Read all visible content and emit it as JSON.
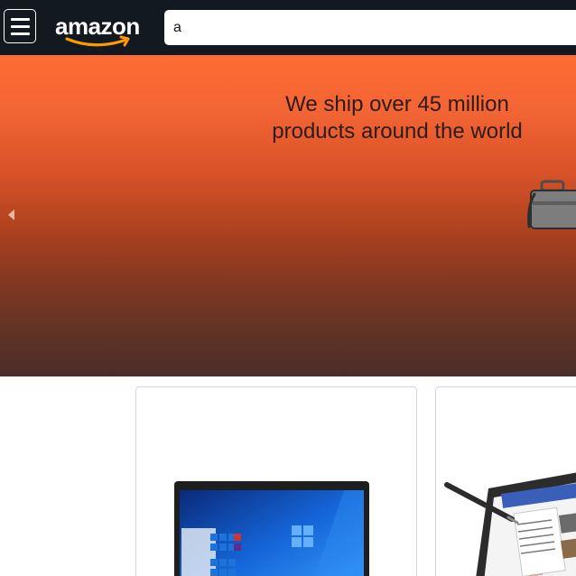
{
  "header": {
    "menu_icon": "hamburger-menu-icon",
    "logo_text": "amazon",
    "search": {
      "value": "a"
    }
  },
  "hero": {
    "headline_line1": "We ship over 45 million",
    "headline_line2": "products around the world",
    "prev_icon": "chevron-left-icon",
    "illustration": "briefcase-icon"
  },
  "products": [
    {
      "image": "laptop-windows-image"
    },
    {
      "image": "convertible-laptop-stylus-image"
    }
  ],
  "colors": {
    "header_bg": "#131921",
    "logo_smile": "#ff9900",
    "hero_top": "#ff6c34",
    "hero_bottom": "#4a2e2a",
    "card_border": "#d5d9d9"
  }
}
